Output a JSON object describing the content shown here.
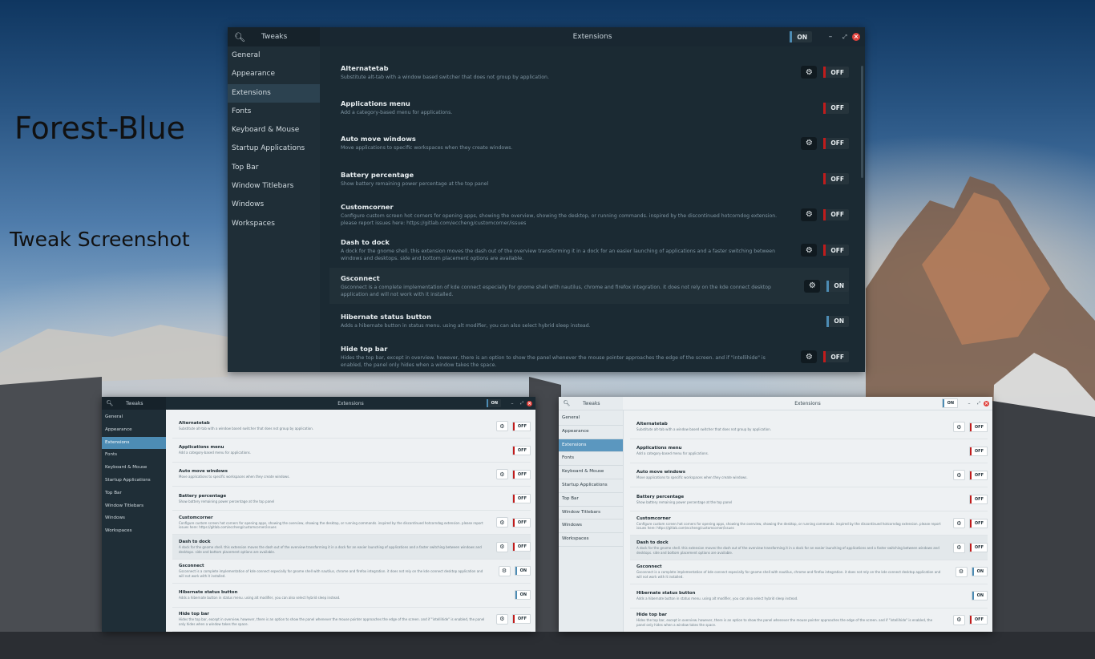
{
  "wallpaper": {
    "title": "Forest-Blue",
    "subtitle": "Tweak Screenshot"
  },
  "app": {
    "name": "Tweaks",
    "page_title": "Extensions",
    "header_switch_label": "ON",
    "controls": {
      "minimize": "–",
      "maximize": "⤢",
      "close": "×"
    }
  },
  "sidebar": {
    "items": [
      {
        "label": "General"
      },
      {
        "label": "Appearance"
      },
      {
        "label": "Extensions",
        "active": true
      },
      {
        "label": "Fonts"
      },
      {
        "label": "Keyboard & Mouse"
      },
      {
        "label": "Startup Applications"
      },
      {
        "label": "Top Bar"
      },
      {
        "label": "Window Titlebars"
      },
      {
        "label": "Windows"
      },
      {
        "label": "Workspaces"
      }
    ]
  },
  "extensions": [
    {
      "name": "Alternatetab",
      "description": "Substitute alt-tab with a window based switcher that does not group by application.",
      "has_settings": true,
      "state": "OFF"
    },
    {
      "name": "Applications menu",
      "description": "Add a category-based menu for applications.",
      "has_settings": false,
      "state": "OFF"
    },
    {
      "name": "Auto move windows",
      "description": "Move applications to specific workspaces when they create windows.",
      "has_settings": true,
      "state": "OFF"
    },
    {
      "name": "Battery percentage",
      "description": "Show battery remaining power percentage at the top panel",
      "has_settings": false,
      "state": "OFF"
    },
    {
      "name": "Customcorner",
      "description": "Configure custom screen hot corners for opening apps, showing the overview, showing the desktop, or running commands. inspired by the discontinued hotcorndog extension. please report issues here: https://gitlab.com/eccheng/customcorner/issues",
      "has_settings": true,
      "state": "OFF"
    },
    {
      "name": "Dash to dock",
      "description": "A dock for the gnome shell. this extension moves the dash out of the overview transforming it in a dock for an easier launching of applications and a faster switching between windows and desktops. side and bottom placement options are available.",
      "has_settings": true,
      "state": "OFF"
    },
    {
      "name": "Gsconnect",
      "description": "Gsconnect is a complete implementation of kde connect especially for gnome shell with nautilus, chrome and firefox integration. it does not rely on the kde connect desktop application and will not work with it installed.",
      "has_settings": true,
      "state": "ON"
    },
    {
      "name": "Hibernate status button",
      "description": "Adds a hibernate button in status menu. using alt modifier, you can also select hybrid sleep instead.",
      "has_settings": false,
      "state": "ON"
    },
    {
      "name": "Hide top bar",
      "description": "Hides the top bar, except in overview. however, there is an option to show the panel whenever the mouse pointer approaches the edge of the screen. and if \"intellihide\" is enabled, the panel only hides when a window takes the space.",
      "has_settings": true,
      "state": "OFF"
    }
  ],
  "colors": {
    "on": "#4d8cb4",
    "off": "#c01c1c",
    "close": "#e0413c",
    "accent": "#4d8cb4"
  }
}
